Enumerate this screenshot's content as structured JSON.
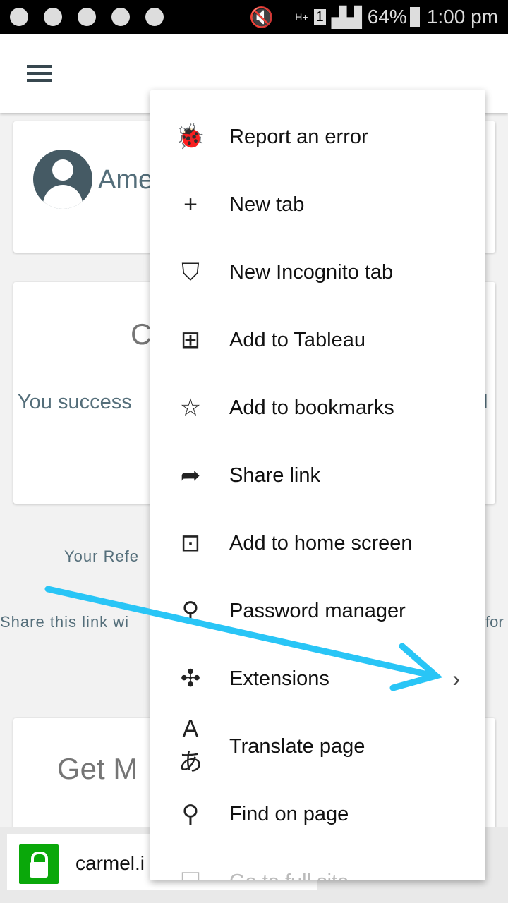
{
  "status_bar": {
    "battery": "64%",
    "time": "1:00 pm",
    "network": "H+",
    "sim": "1"
  },
  "page": {
    "name_partial": "Ame",
    "card_title_partial": "C",
    "success_partial": "You success",
    "success_right_partial": "l",
    "referral_partial": "Your Refe",
    "share_partial": "Share this link wi",
    "share_right_partial": "for",
    "get_more_partial": "Get M"
  },
  "menu": {
    "items": [
      {
        "icon": "bug-icon",
        "glyph": "🐞",
        "label": "Report an error"
      },
      {
        "icon": "plus-icon",
        "glyph": "+",
        "label": "New tab"
      },
      {
        "icon": "incognito-mask-icon",
        "glyph": "⛉",
        "label": "New Incognito tab"
      },
      {
        "icon": "add-tab-icon",
        "glyph": "⊞",
        "label": "Add to Tableau"
      },
      {
        "icon": "star-icon",
        "glyph": "☆",
        "label": "Add to bookmarks"
      },
      {
        "icon": "share-icon",
        "glyph": "➦",
        "label": "Share link"
      },
      {
        "icon": "home-screen-icon",
        "glyph": "⊡",
        "label": "Add to home screen"
      },
      {
        "icon": "key-icon",
        "glyph": "⚲",
        "label": "Password manager"
      },
      {
        "icon": "puzzle-icon",
        "glyph": "✣",
        "label": "Extensions",
        "chevron": "›"
      },
      {
        "icon": "translate-icon",
        "glyph": "Aあ",
        "label": "Translate page"
      },
      {
        "icon": "search-icon",
        "glyph": "⚲",
        "label": "Find on page"
      },
      {
        "icon": "desktop-icon",
        "glyph": "☐",
        "label": "Go to full site"
      }
    ]
  },
  "url_bar": {
    "url_partial": "carmel.i"
  },
  "annotation": {
    "arrow_color": "#29c5f6"
  }
}
